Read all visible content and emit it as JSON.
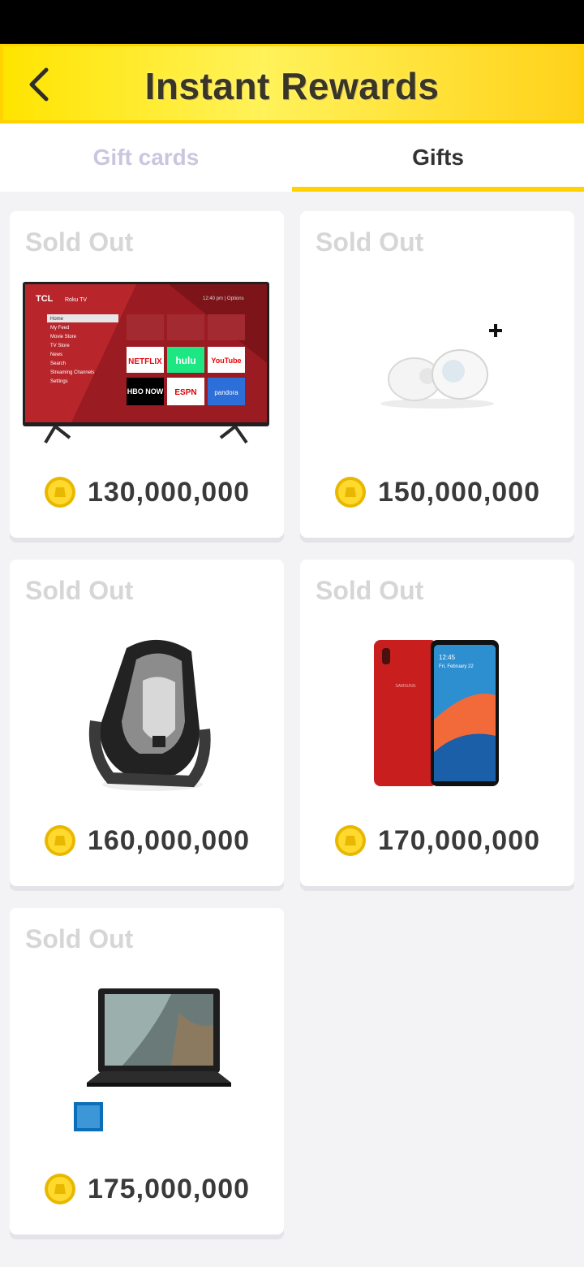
{
  "header": {
    "title": "Instant Rewards",
    "back_icon": "chevron-left-icon",
    "gradient": [
      "#ffe400",
      "#fff25a",
      "#ffd21a"
    ]
  },
  "tabs": [
    {
      "label": "Gift cards",
      "active": false
    },
    {
      "label": "Gifts",
      "active": true
    }
  ],
  "accent_color": "#ffd200",
  "products": [
    {
      "status": "Sold Out",
      "price": "130,000,000",
      "image": "tv-icon"
    },
    {
      "status": "Sold Out",
      "price": "150,000,000",
      "image": "earbuds-icon"
    },
    {
      "status": "Sold Out",
      "price": "160,000,000",
      "image": "car-seat-icon"
    },
    {
      "status": "Sold Out",
      "price": "170,000,000",
      "image": "smartphone-icon"
    },
    {
      "status": "Sold Out",
      "price": "175,000,000",
      "image": "laptop-icon"
    }
  ],
  "tv_apps": [
    "NETFLIX",
    "hulu",
    "YouTube",
    "HBO NOW",
    "ESPN",
    "pandora"
  ],
  "tv_brand": "TCL",
  "tv_brand_sub": "Roku TV",
  "tv_menu": [
    "Home",
    "My Feed",
    "Movie Store",
    "TV Store",
    "News",
    "Search",
    "Streaming Channels",
    "Settings"
  ],
  "tv_time": "12:40 pm  |  Options",
  "phone_brand": "SAMSUNG",
  "phone_time": "12:45",
  "phone_date": "Fri, February 22"
}
